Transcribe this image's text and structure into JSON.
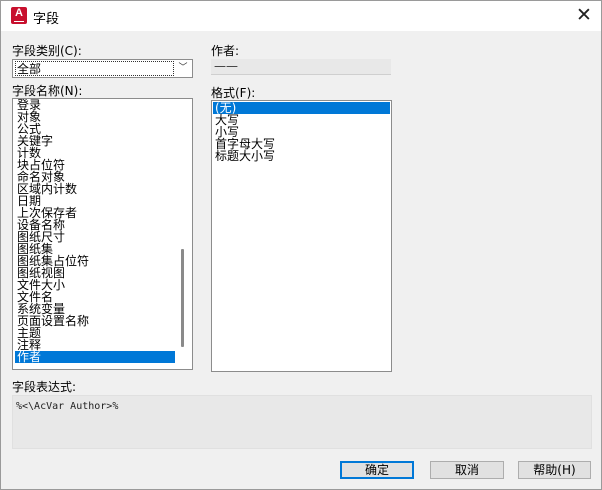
{
  "window": {
    "title": "字段",
    "app_icon_letter": "A",
    "close_glyph": "✕"
  },
  "category": {
    "label": "字段类别(C):",
    "selected": "全部",
    "arrow_glyph": "﹀"
  },
  "field_names": {
    "label": "字段名称(N):",
    "items": [
      "登录",
      "对象",
      "公式",
      "关键字",
      "计数",
      "块占位符",
      "命名对象",
      "区域内计数",
      "日期",
      "上次保存者",
      "设备名称",
      "图纸尺寸",
      "图纸集",
      "图纸集占位符",
      "图纸视图",
      "文件大小",
      "文件名",
      "系统变量",
      "页面设置名称",
      "主题",
      "注释",
      "作者"
    ],
    "selected": "作者"
  },
  "author": {
    "label": "作者:",
    "value": "——"
  },
  "format": {
    "label": "格式(F):",
    "items": [
      "(无)",
      "大写",
      "小写",
      "首字母大写",
      "标题大小写"
    ],
    "selected": "(无)"
  },
  "expression": {
    "label": "字段表达式:",
    "value": "%<\\AcVar Author>%"
  },
  "buttons": {
    "ok": "确定",
    "cancel": "取消",
    "help": "帮助(H)"
  },
  "colors": {
    "selection": "#0078d7",
    "brand": "#c8102e"
  }
}
